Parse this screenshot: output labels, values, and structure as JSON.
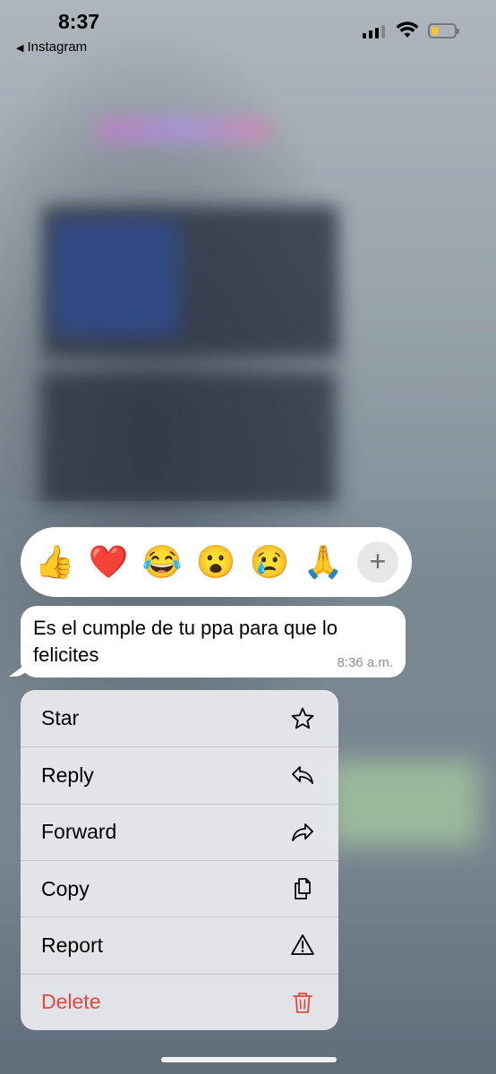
{
  "status_bar": {
    "time": "8:37",
    "back_label": "Instagram",
    "battery_color": "#f2c23a"
  },
  "reactions": {
    "emojis": [
      "👍",
      "❤️",
      "😂",
      "😮",
      "😢",
      "🙏"
    ],
    "more_label": "+"
  },
  "message": {
    "text": "Es el cumple de tu ppa para que lo felicites",
    "time": "8:36 a.m."
  },
  "menu": {
    "items": [
      {
        "label": "Star",
        "icon": "star-icon"
      },
      {
        "label": "Reply",
        "icon": "reply-icon"
      },
      {
        "label": "Forward",
        "icon": "forward-icon"
      },
      {
        "label": "Copy",
        "icon": "copy-icon"
      },
      {
        "label": "Report",
        "icon": "warning-icon"
      },
      {
        "label": "Delete",
        "icon": "trash-icon",
        "color": "#e5493a"
      }
    ]
  }
}
